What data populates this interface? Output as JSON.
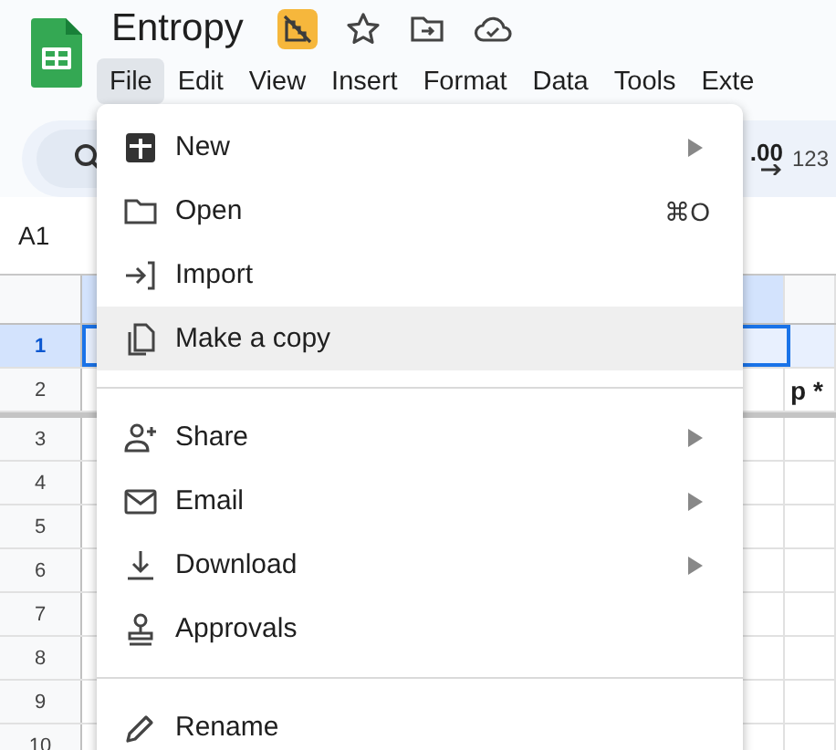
{
  "document": {
    "title": "Entropy"
  },
  "menubar": [
    {
      "label": "File",
      "selected": true
    },
    {
      "label": "Edit",
      "selected": false
    },
    {
      "label": "View",
      "selected": false
    },
    {
      "label": "Insert",
      "selected": false
    },
    {
      "label": "Format",
      "selected": false
    },
    {
      "label": "Data",
      "selected": false
    },
    {
      "label": "Tools",
      "selected": false
    },
    {
      "label": "Exte",
      "selected": false
    }
  ],
  "toolbar": {
    "decimal_label": ".00",
    "format_label": "123"
  },
  "name_box": "A1",
  "sheet": {
    "column_headers": [
      {
        "selected": true
      },
      {
        "selected": false
      }
    ],
    "rows": [
      {
        "number": "1",
        "selected": true
      },
      {
        "number": "2",
        "selected": false,
        "column_2": "p *"
      },
      {
        "number": "3",
        "selected": false
      },
      {
        "number": "4",
        "selected": false
      },
      {
        "number": "5",
        "selected": false
      },
      {
        "number": "6",
        "selected": false
      },
      {
        "number": "7",
        "selected": false
      },
      {
        "number": "8",
        "selected": false
      },
      {
        "number": "9",
        "selected": false
      },
      {
        "number": "10",
        "selected": false
      }
    ]
  },
  "file_menu": {
    "items": [
      {
        "kind": "item",
        "label": "New",
        "submenu": true,
        "highlighted": false
      },
      {
        "kind": "item",
        "label": "Open",
        "shortcut": "⌘O",
        "submenu": false,
        "highlighted": false
      },
      {
        "kind": "item",
        "label": "Import",
        "submenu": false,
        "highlighted": false
      },
      {
        "kind": "item",
        "label": "Make a copy",
        "submenu": false,
        "highlighted": true
      },
      {
        "kind": "divider"
      },
      {
        "kind": "item",
        "label": "Share",
        "submenu": true,
        "highlighted": false
      },
      {
        "kind": "item",
        "label": "Email",
        "submenu": true,
        "highlighted": false
      },
      {
        "kind": "item",
        "label": "Download",
        "submenu": true,
        "highlighted": false
      },
      {
        "kind": "item",
        "label": "Approvals",
        "submenu": false,
        "highlighted": false
      },
      {
        "kind": "divider"
      },
      {
        "kind": "item",
        "label": "Rename",
        "submenu": false,
        "highlighted": false
      }
    ]
  }
}
